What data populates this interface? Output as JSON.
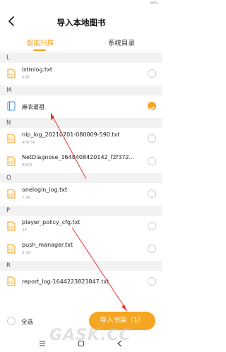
{
  "status": {
    "battery": "88%"
  },
  "header": {
    "title": "导入本地图书"
  },
  "tabs": [
    {
      "label": "智能扫描",
      "active": true
    },
    {
      "label": "系统目录",
      "active": false
    }
  ],
  "sections": [
    {
      "letter": "L",
      "files": [
        {
          "name": "lstmlog.txt",
          "size": "63B",
          "checked": false,
          "icon": "txt-file-icon"
        }
      ]
    },
    {
      "letter": "M",
      "files": [
        {
          "name": "麻衣道祖",
          "size": "",
          "checked": true,
          "icon": "book-file-icon"
        }
      ]
    },
    {
      "letter": "N",
      "files": [
        {
          "name": "nlp_log_20210701-080009-590.txt",
          "size": "409.5K",
          "checked": false,
          "icon": "txt-file-icon"
        },
        {
          "name": "NetDiagnose_1648408420142_f2f372...",
          "size": "866B",
          "checked": false,
          "icon": "txt-file-icon"
        }
      ]
    },
    {
      "letter": "O",
      "files": [
        {
          "name": "onelogin_log.txt",
          "size": "7.6K",
          "checked": false,
          "icon": "txt-file-icon"
        }
      ]
    },
    {
      "letter": "P",
      "files": [
        {
          "name": "player_policy_cfg.txt",
          "size": "2K",
          "checked": false,
          "icon": "txt-file-icon"
        },
        {
          "name": "push_manager.txt",
          "size": "3.1K",
          "checked": false,
          "icon": "txt-file-icon"
        }
      ]
    },
    {
      "letter": "R",
      "files": [
        {
          "name": "report_log-1644223823847.txt",
          "size": "",
          "checked": false,
          "icon": "txt-file-icon"
        }
      ]
    }
  ],
  "bottom": {
    "select_all": "全选",
    "import_button": "导入书架（1）"
  },
  "watermark": "GASK.CC",
  "colors": {
    "accent": "#f5a623",
    "annotation": "#e23b2e"
  }
}
